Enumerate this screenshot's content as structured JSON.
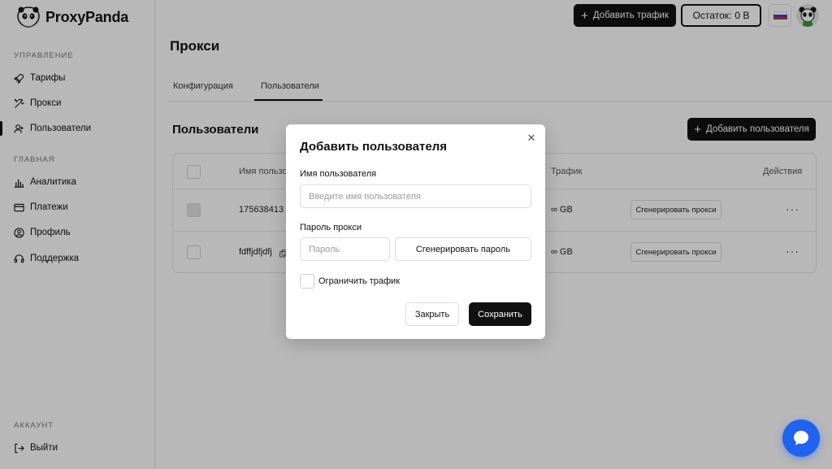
{
  "app": {
    "brand": "ProxyPanda"
  },
  "sidebar": {
    "management_title": "УПРАВЛЕНИЕ",
    "management_items": [
      {
        "label": "Тарифы",
        "icon": "rocket-icon"
      },
      {
        "label": "Прокси",
        "icon": "tools-icon"
      },
      {
        "label": "Пользователи",
        "icon": "user-add-icon",
        "active": true
      }
    ],
    "main_title": "ГЛАВНАЯ",
    "main_items": [
      {
        "label": "Аналитика",
        "icon": "bar-chart-icon"
      },
      {
        "label": "Платежи",
        "icon": "card-icon"
      },
      {
        "label": "Профиль",
        "icon": "profile-icon"
      },
      {
        "label": "Поддержка",
        "icon": "headset-icon"
      }
    ],
    "account_title": "АККАУНТ",
    "account_items": [
      {
        "label": "Выйти",
        "icon": "logout-icon"
      }
    ]
  },
  "topbar": {
    "add_traffic_label": "Добавить трафик",
    "balance_label": "Остаток:",
    "balance_value": "0 B"
  },
  "page": {
    "title": "Прокси",
    "tabs": [
      {
        "label": "Конфигурация",
        "active": false
      },
      {
        "label": "Пользователи",
        "active": true
      }
    ],
    "section_title": "Пользователи",
    "add_user_label": "Добавить пользователя"
  },
  "table": {
    "columns": [
      "Имя пользо",
      "Трафик",
      "Действия"
    ],
    "rows": [
      {
        "name": "175638413",
        "traffic": "∞ GB",
        "action_label": "Сгенерировать прокси"
      },
      {
        "name": "fdffjdfjdfj",
        "traffic": "∞ GB",
        "action_label": "Сгенерировать прокси"
      }
    ]
  },
  "modal": {
    "title": "Добавить пользователя",
    "username_label": "Имя пользователя",
    "username_placeholder": "Введите имя пользователя",
    "username_value": "",
    "password_label": "Пароль прокси",
    "password_placeholder": "Пароль",
    "password_value": "",
    "generate_password_label": "Сгенерировать пароль",
    "limit_traffic_label": "Ограничить трафик",
    "limit_traffic_checked": false,
    "close_label": "Закрыть",
    "save_label": "Сохранить"
  },
  "colors": {
    "accent_dark": "#111111",
    "chat_blue": "#1f63f0",
    "logo_green": "#3f9a3a"
  }
}
